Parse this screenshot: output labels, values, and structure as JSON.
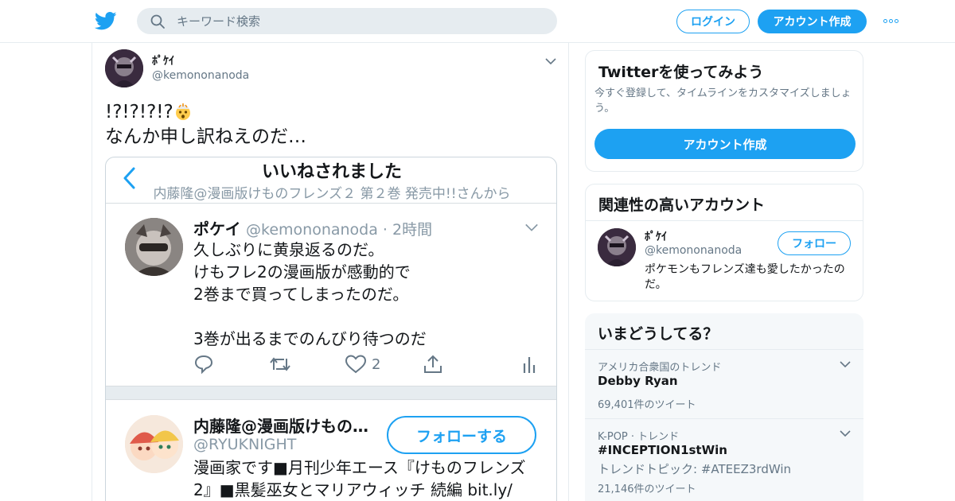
{
  "header": {
    "search_placeholder": "キーワード検索",
    "login_label": "ログイン",
    "signup_label": "アカウント作成"
  },
  "tweet": {
    "display_name": "ﾎﾟｹｲ",
    "handle": "@kemononanoda",
    "text_line1": "!?!?!?!?",
    "text_line2": "なんか申し訳ねえのだ…",
    "emoji": "exploding-head-emoji"
  },
  "embed": {
    "title": "いいねされました",
    "subtitle": "内藤隆@漫画版けものフレンズ２ 第２巻 発売中!!さんから",
    "tweet": {
      "name": "ポケイ",
      "handle_time": "@kemononanoda · 2時間",
      "lines": [
        "久しぶりに黄泉返るのだ。",
        "けもフレ2の漫画版が感動的で",
        "2巻まで買ってしまったのだ。",
        "",
        "3巻が出るまでのんびり待つのだ"
      ],
      "like_count": "2"
    },
    "account": {
      "name": "内藤隆@漫画版けもの…",
      "handle": "@RYUKNIGHT",
      "follow_label": "フォローする",
      "bio_line1": "漫画家です■月刊少年エース『けものフレンズ",
      "bio_line2": "2』■黒髪巫女とマリアウィッチ 続編 bit.ly/"
    }
  },
  "sidebar": {
    "signup_card": {
      "title": "Twitterを使ってみよう",
      "desc": "今すぐ登録して、タイムラインをカスタマイズしましょう。",
      "button": "アカウント作成"
    },
    "related": {
      "title": "関連性の高いアカウント",
      "name": "ﾎﾟｹｲ",
      "handle": "@kemononanoda",
      "follow_label": "フォロー",
      "bio": "ポケモンもフレンズ達も愛したかったのだ。"
    },
    "trends": {
      "title": "いまどうしてる？",
      "items": [
        {
          "context": "アメリカ合衆国のトレンド",
          "name": "Debby Ryan",
          "count": "69,401件のツイート"
        },
        {
          "context": "K-POP · トレンド",
          "name": "#INCEPTION1stWin",
          "topic": "トレンドトピック: #ATEEZ3rdWin",
          "count": "21,146件のツイート"
        }
      ]
    }
  },
  "colors": {
    "accent": "#1da1f2",
    "text": "#14171a",
    "muted": "#657786",
    "border": "#e6ecf0"
  }
}
